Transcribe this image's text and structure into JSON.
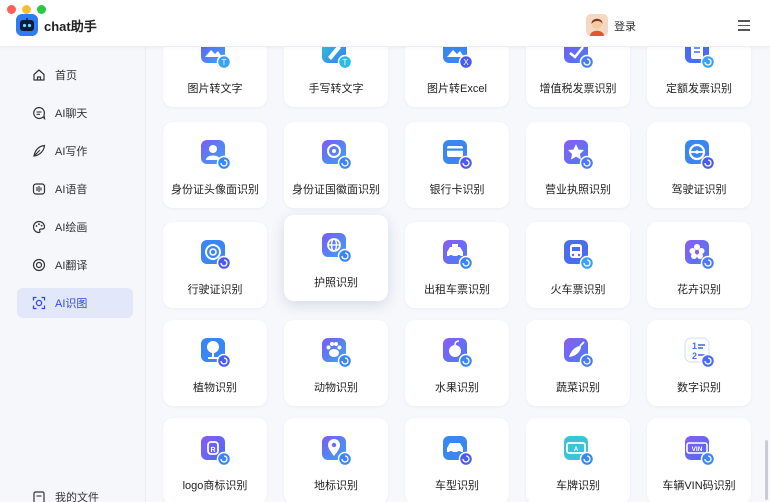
{
  "app": {
    "title": "chat助手",
    "login": "登录"
  },
  "sidebar": {
    "items": [
      {
        "label": "首页",
        "icon": "home-icon"
      },
      {
        "label": "AI聊天",
        "icon": "chat-icon"
      },
      {
        "label": "AI写作",
        "icon": "feather-icon"
      },
      {
        "label": "AI语音",
        "icon": "voice-icon"
      },
      {
        "label": "AI绘画",
        "icon": "palette-icon"
      },
      {
        "label": "AI翻译",
        "icon": "translate-icon"
      },
      {
        "label": "AI识图",
        "icon": "scan-icon",
        "active": true
      }
    ],
    "footer": "我的文件"
  },
  "cards": [
    {
      "label": "图片转文字",
      "icon": "image-to-text-icon"
    },
    {
      "label": "手写转文字",
      "icon": "handwriting-icon"
    },
    {
      "label": "图片转Excel",
      "icon": "excel-icon"
    },
    {
      "label": "增值税发票识别",
      "icon": "vat-invoice-icon"
    },
    {
      "label": "定额发票识别",
      "icon": "quota-invoice-icon"
    },
    {
      "label": "身份证头像面识别",
      "icon": "id-card-front-icon"
    },
    {
      "label": "身份证国徽面识别",
      "icon": "id-card-back-icon"
    },
    {
      "label": "银行卡识别",
      "icon": "bank-card-icon"
    },
    {
      "label": "营业执照识别",
      "icon": "business-license-icon"
    },
    {
      "label": "驾驶证识别",
      "icon": "driver-license-icon"
    },
    {
      "label": "行驶证识别",
      "icon": "vehicle-license-icon"
    },
    {
      "label": "护照识别",
      "icon": "passport-icon"
    },
    {
      "label": "出租车票识别",
      "icon": "taxi-icon"
    },
    {
      "label": "火车票识别",
      "icon": "train-icon"
    },
    {
      "label": "花卉识别",
      "icon": "flower-icon"
    },
    {
      "label": "植物识别",
      "icon": "plant-icon"
    },
    {
      "label": "动物识别",
      "icon": "paw-icon"
    },
    {
      "label": "水果识别",
      "icon": "fruit-icon"
    },
    {
      "label": "蔬菜识别",
      "icon": "vegetable-icon"
    },
    {
      "label": "数字识别",
      "icon": "number-icon"
    },
    {
      "label": "logo商标识别",
      "icon": "logo-icon"
    },
    {
      "label": "地标识别",
      "icon": "landmark-icon"
    },
    {
      "label": "车型识别",
      "icon": "car-icon"
    },
    {
      "label": "车牌识别",
      "icon": "plate-icon"
    },
    {
      "label": "车辆VIN码识别",
      "icon": "vin-icon"
    }
  ],
  "colors": {
    "accent": "#3b4bd8",
    "icon_gradient_start": "#6a5cf5",
    "icon_gradient_end": "#3aa4f4"
  }
}
